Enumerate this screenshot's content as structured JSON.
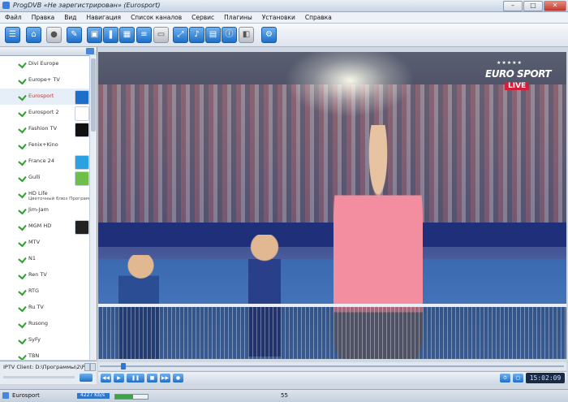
{
  "window": {
    "title": "ProgDVB «Не зарегистрирован» (Eurosport)",
    "minimize": "–",
    "maximize": "□",
    "close": "✕"
  },
  "menu": [
    "Файл",
    "Правка",
    "Вид",
    "Навигация",
    "Список каналов",
    "Сервис",
    "Плагины",
    "Установки",
    "Справка"
  ],
  "channels": [
    {
      "name": "Divi Europe",
      "sub": ""
    },
    {
      "name": "Europe+ TV",
      "sub": ""
    },
    {
      "name": "Eurosport",
      "sub": "",
      "selected": true
    },
    {
      "name": "Eurosport 2",
      "sub": ""
    },
    {
      "name": "Fashion TV",
      "sub": ""
    },
    {
      "name": "Fenix+Kino",
      "sub": ""
    },
    {
      "name": "France 24",
      "sub": ""
    },
    {
      "name": "Gulli",
      "sub": ""
    },
    {
      "name": "HD Life",
      "sub": "Цветочный блюз Программ..."
    },
    {
      "name": "Jim-Jam",
      "sub": ""
    },
    {
      "name": "MGM HD",
      "sub": ""
    },
    {
      "name": "MTV",
      "sub": ""
    },
    {
      "name": "N1",
      "sub": ""
    },
    {
      "name": "Ren TV",
      "sub": ""
    },
    {
      "name": "RTG",
      "sub": ""
    },
    {
      "name": "Ru TV",
      "sub": ""
    },
    {
      "name": "Rusong",
      "sub": ""
    },
    {
      "name": "SyFy",
      "sub": ""
    },
    {
      "name": "TBN",
      "sub": ""
    }
  ],
  "video": {
    "logo_brand": "EURO SPORT",
    "logo_live": "LIVE"
  },
  "footer": {
    "path": "IPTV Client: D:\\Программы\\2\\Разное"
  },
  "player": {
    "clock": "15:02:09"
  },
  "status": {
    "channel": "Eurosport",
    "progress_label": "4227 Kb/s",
    "signal_level": 0.55,
    "number": "55"
  }
}
